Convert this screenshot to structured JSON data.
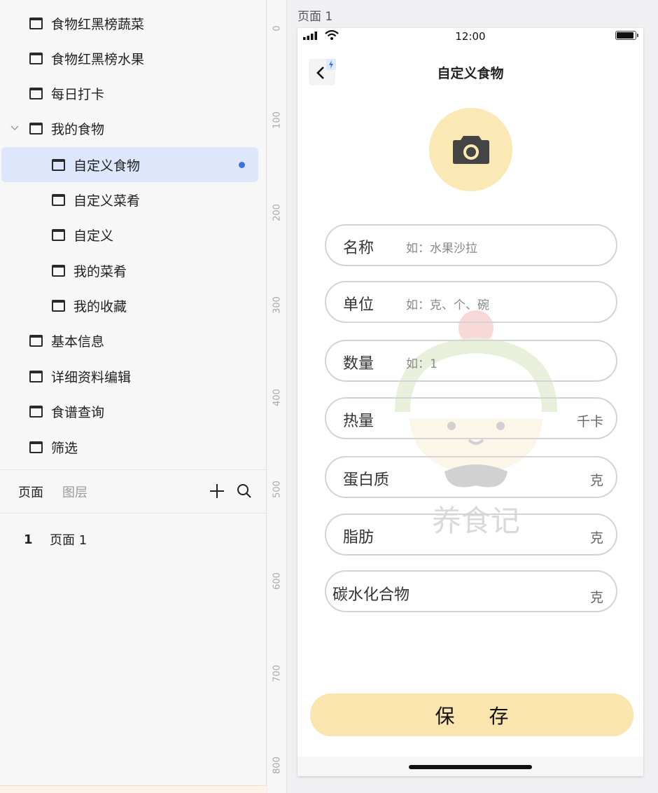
{
  "sidebar": {
    "items": [
      {
        "label": "食物红黑榜蔬菜"
      },
      {
        "label": "食物红黑榜水果"
      },
      {
        "label": "每日打卡"
      },
      {
        "label": "我的食物"
      },
      {
        "label": "自定义食物"
      },
      {
        "label": "自定义菜肴"
      },
      {
        "label": "自定义"
      },
      {
        "label": "我的菜肴"
      },
      {
        "label": "我的收藏"
      },
      {
        "label": "基本信息"
      },
      {
        "label": "详细资料编辑"
      },
      {
        "label": "食谱查询"
      },
      {
        "label": "筛选"
      }
    ],
    "tabs": {
      "pages": "页面",
      "layers": "图层"
    },
    "page_list": [
      {
        "num": "1",
        "name": "页面 1"
      }
    ]
  },
  "ruler": {
    "ticks": [
      "0",
      "100",
      "200",
      "300",
      "400",
      "500",
      "600",
      "700",
      "800"
    ]
  },
  "canvas": {
    "label": "页面 1"
  },
  "phone": {
    "time": "12:00",
    "title": "自定义食物",
    "fields": [
      {
        "label": "名称",
        "placeholder": "如：水果沙拉",
        "unit": ""
      },
      {
        "label": "单位",
        "placeholder": "如：克、个、碗",
        "unit": ""
      },
      {
        "label": "数量",
        "placeholder": "如：1",
        "unit": ""
      },
      {
        "label": "热量",
        "placeholder": "",
        "unit": "千卡"
      },
      {
        "label": "蛋白质",
        "placeholder": "",
        "unit": "克"
      },
      {
        "label": "脂肪",
        "placeholder": "",
        "unit": "克"
      },
      {
        "label": "碳水化合物",
        "placeholder": "",
        "unit": "克"
      }
    ],
    "save_label": "保 存",
    "watermark_text": "养食记",
    "colors": {
      "accent": "#fae8b5",
      "save": "#f9e5ad",
      "selected_bg": "#dde6fb",
      "dot": "#3a73e0"
    }
  }
}
